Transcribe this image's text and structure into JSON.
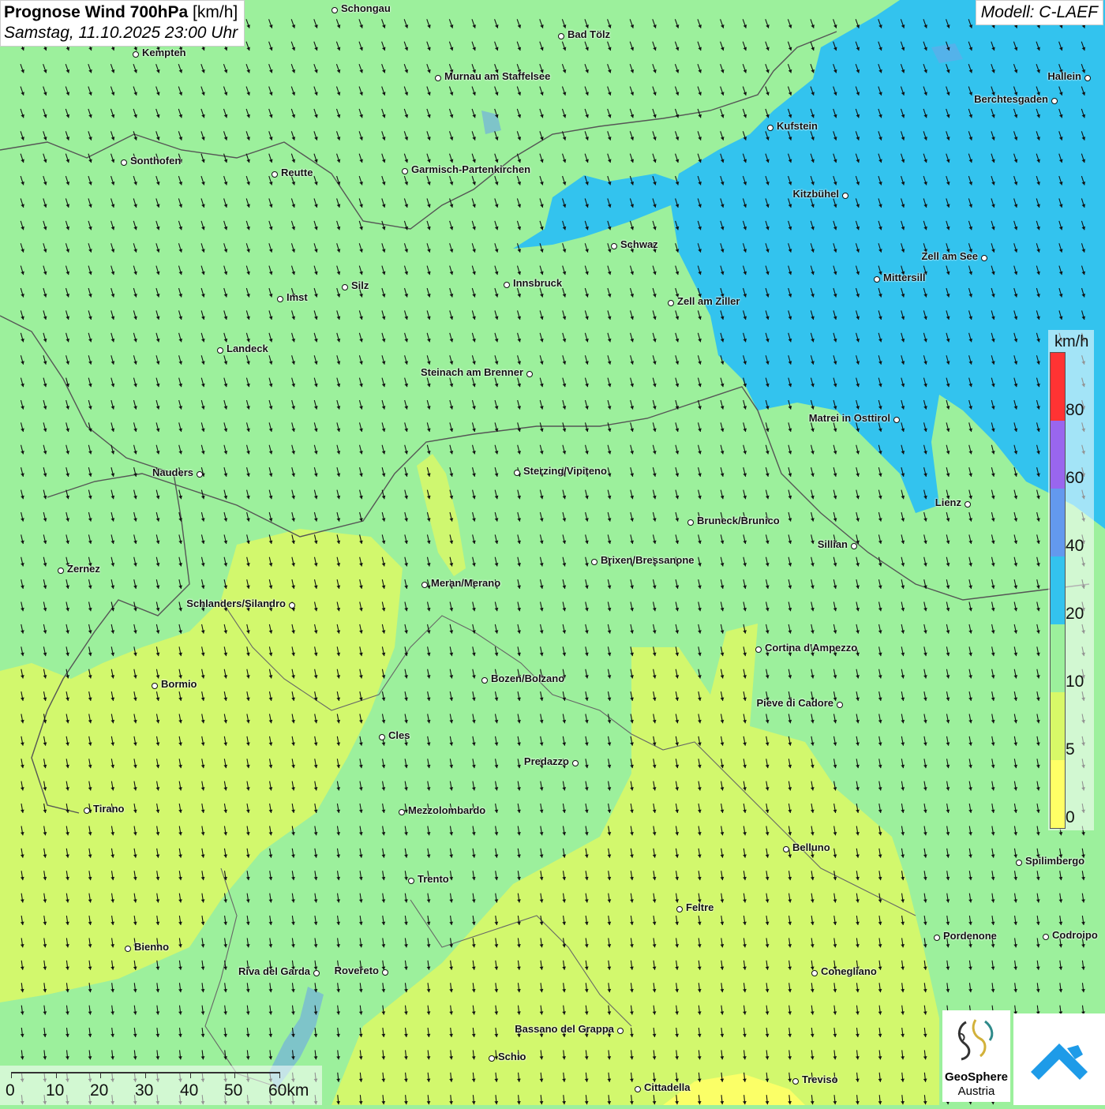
{
  "header": {
    "title": "Prognose Wind 700hPa",
    "unit": "[km/h]",
    "datetime": "Samstag, 11.10.2025 23:00 Uhr"
  },
  "model_label": "Modell: C-LAEF",
  "colors": {
    "calm_yellow": "#ffff66",
    "light_yellowgreen": "#d8f868",
    "green": "#9cf09c",
    "cyan": "#33c3ee",
    "blue": "#6399ee",
    "purple": "#9966ee",
    "red": "#ff3333"
  },
  "legend": {
    "unit": "km/h",
    "labels": [
      "80",
      "60",
      "40",
      "20",
      "10",
      "5",
      "0"
    ]
  },
  "cities": [
    {
      "name": "Schongau"
    },
    {
      "name": "Bad Tölz"
    },
    {
      "name": "Kempten"
    },
    {
      "name": "Murnau am Staffelsee"
    },
    {
      "name": "Hallein"
    },
    {
      "name": "Berchtesgaden"
    },
    {
      "name": "Kufstein"
    },
    {
      "name": "Sonthofen"
    },
    {
      "name": "Reutte"
    },
    {
      "name": "Garmisch-Partenkirchen"
    },
    {
      "name": "Kitzbühel"
    },
    {
      "name": "Schwaz"
    },
    {
      "name": "Zell am See"
    },
    {
      "name": "Mittersill"
    },
    {
      "name": "Innsbruck"
    },
    {
      "name": "Silz"
    },
    {
      "name": "Imst"
    },
    {
      "name": "Zell am Ziller"
    },
    {
      "name": "Landeck"
    },
    {
      "name": "Steinach am Brenner"
    },
    {
      "name": "Matrei in Osttirol"
    },
    {
      "name": "Nauders"
    },
    {
      "name": "Sterzing/Vipiteno"
    },
    {
      "name": "Lienz"
    },
    {
      "name": "Bruneck/Brunico"
    },
    {
      "name": "Sillian"
    },
    {
      "name": "Zernez"
    },
    {
      "name": "Brixen/Bressanone"
    },
    {
      "name": "Meran/Merano"
    },
    {
      "name": "Schlanders/Silandro"
    },
    {
      "name": "Cortina d'Ampezzo"
    },
    {
      "name": "Bormio"
    },
    {
      "name": "Bozen/Bolzano"
    },
    {
      "name": "Pieve di Cadore"
    },
    {
      "name": "Cles"
    },
    {
      "name": "Predazzo"
    },
    {
      "name": "Tirano"
    },
    {
      "name": "Mezzolombardo"
    },
    {
      "name": "Belluno"
    },
    {
      "name": "Spilimbergo"
    },
    {
      "name": "Trento"
    },
    {
      "name": "Feltre"
    },
    {
      "name": "Pordenone"
    },
    {
      "name": "Codroipo"
    },
    {
      "name": "Bienno"
    },
    {
      "name": "Riva del Garda"
    },
    {
      "name": "Rovereto"
    },
    {
      "name": "Conegliano"
    },
    {
      "name": "Bassano del Grappa"
    },
    {
      "name": "Schio"
    },
    {
      "name": "Treviso"
    },
    {
      "name": "Cittadella"
    }
  ],
  "scale_bar": {
    "labels": [
      "0",
      "10",
      "20",
      "30",
      "40",
      "50",
      "60km"
    ]
  },
  "logo": {
    "name": "GeoSphere",
    "sub": "Austria"
  },
  "wind_field": {
    "direction": "from north-northwest (arrows pointing south-southeast)"
  }
}
